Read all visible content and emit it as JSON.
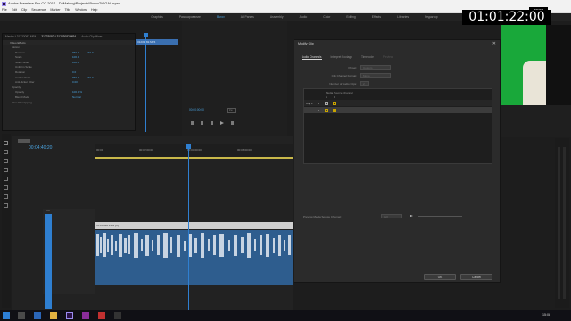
{
  "app": {
    "title": "Adobe Premiere Pro CC 2017 - D:\\Making\\Projects\\Burov7\\GGAl.prproj",
    "menu": [
      "File",
      "Edit",
      "Clip",
      "Sequence",
      "Marker",
      "Title",
      "Window",
      "Help"
    ]
  },
  "workspaces": {
    "items": [
      "Graphics",
      "Разочарование",
      "Burov",
      "All Panels",
      "Assembly",
      "Audio",
      "Color",
      "Editing",
      "Effects",
      "Libraries",
      "Редактор"
    ],
    "active_index": 2
  },
  "effect_controls": {
    "tabs": [
      "Master * 31233082.MP4",
      "31233082 * 31233082.MP4",
      "Audio Clip Mixer"
    ],
    "header": "Video Effects",
    "clip_label": "31233082.MP4",
    "rows": [
      {
        "label": "Motion",
        "v1": "",
        "v2": ""
      },
      {
        "label": "Position",
        "v1": "960.0",
        "v2": "540.0"
      },
      {
        "label": "Scale",
        "v1": "100.0",
        "v2": ""
      },
      {
        "label": "Scale Width",
        "v1": "100.0",
        "v2": ""
      },
      {
        "label": "Uniform Scale",
        "v1": "",
        "v2": ""
      },
      {
        "label": "Rotation",
        "v1": "0.0",
        "v2": ""
      },
      {
        "label": "Anchor Point",
        "v1": "960.0",
        "v2": "540.0"
      },
      {
        "label": "Anti-flicker Filter",
        "v1": "0.00",
        "v2": ""
      },
      {
        "label": "Opacity",
        "v1": "",
        "v2": ""
      },
      {
        "label": "Opacity",
        "v1": "100.0 %",
        "v2": ""
      },
      {
        "label": "Blend Mode",
        "v1": "Normal",
        "v2": ""
      },
      {
        "label": "Time Remapping",
        "v1": "",
        "v2": ""
      }
    ]
  },
  "source_monitor": {
    "timecode": "00:00:00:00",
    "fit": "Fit"
  },
  "timeline": {
    "timecode": "00:04:40:20",
    "ruler": [
      "00:00",
      "00:02:00:00",
      "00:04:00:00",
      "00:06:00:00"
    ],
    "video_tracks": [
      "V3",
      "V2",
      "V1"
    ],
    "audio_tracks": [
      "A1",
      "A2",
      "A3"
    ],
    "clip_name": "31233082.MP4 [V]"
  },
  "dialog": {
    "title": "Modify Clip",
    "close": "✕",
    "tabs": [
      "Audio Channels",
      "Interpret Footage",
      "Timecode",
      "Preview"
    ],
    "active_tab": 0,
    "fields": [
      {
        "label": "Preset:",
        "value": "Custom"
      },
      {
        "label": "Clip Channel Format:",
        "value": "Mono"
      },
      {
        "label": "Number of Audio Clips:",
        "value": "2"
      }
    ],
    "grid_header": "Media Source Channel",
    "grid_cols": [
      "L",
      "R"
    ],
    "clip_row_label": "Clip 1",
    "channel_rows": [
      "L",
      "R"
    ],
    "preview_label": "Preview Media Source Channel:",
    "preview_value": "Left",
    "ok_label": "OK",
    "cancel_label": "Cancel"
  },
  "overlay": {
    "timecode_big": "01:01:22:00",
    "timecode_small": "00:00"
  },
  "taskbar": {
    "time": "15:08"
  },
  "colors": {
    "accent": "#4aa3df",
    "playhead": "#2f7fd0",
    "audio_wave": "#2e5d8e",
    "green_screen": "#19a83a"
  }
}
